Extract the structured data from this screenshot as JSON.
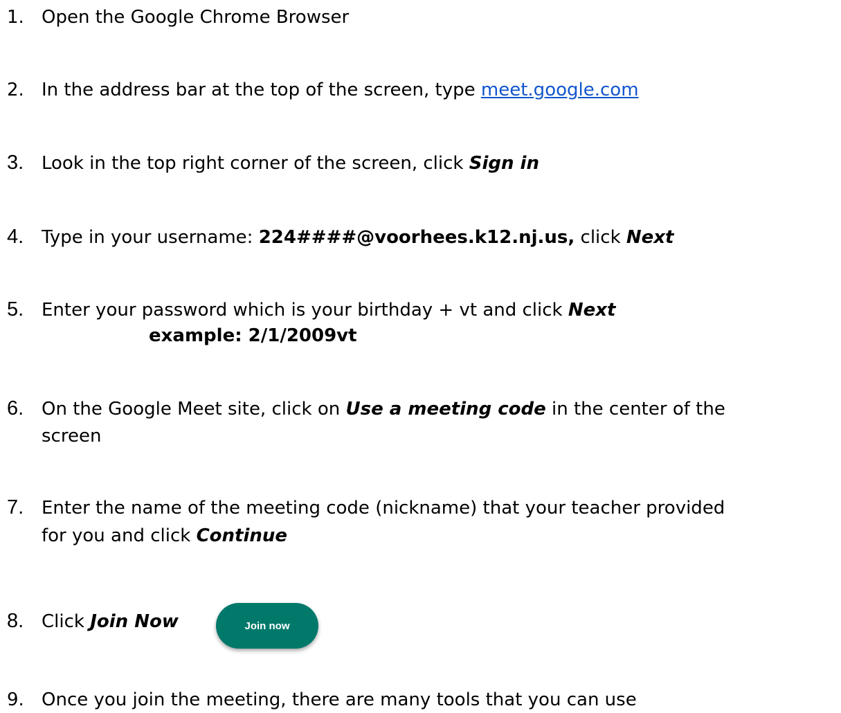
{
  "steps": [
    {
      "num": "1.",
      "text": "Open the Google Chrome Browser"
    },
    {
      "num": "2.",
      "text": "In the address bar at the top of the screen, type ",
      "link": "meet.google.com"
    },
    {
      "num": "3.",
      "text": "Look in the top right corner of the screen, click ",
      "action": "Sign in"
    },
    {
      "num": "4.",
      "text": "Type in your username: ",
      "username": "224####@voorhees.k12.nj.us,",
      "text2": " click ",
      "action": "Next"
    },
    {
      "num": "5.",
      "text": "Enter your password which is your birthday + vt  and click ",
      "action": "Next",
      "example": "example: 2/1/2009vt"
    },
    {
      "num": "6.",
      "text": "On the Google Meet site, click on ",
      "action": "Use a meeting code",
      "text2": " in the center of the",
      "cont": "screen"
    },
    {
      "num": "7.",
      "text": "Enter the name of the meeting code (nickname) that your teacher provided",
      "cont": "for you and click ",
      "action": "Continue"
    },
    {
      "num": "8.",
      "text": "Click ",
      "action": "Join Now",
      "button": "Join now"
    },
    {
      "num": "9.",
      "text": "Once you join the meeting, there are many tools that you can use"
    }
  ],
  "colors": {
    "link": "#1155cc",
    "join_button": "#00796b"
  }
}
